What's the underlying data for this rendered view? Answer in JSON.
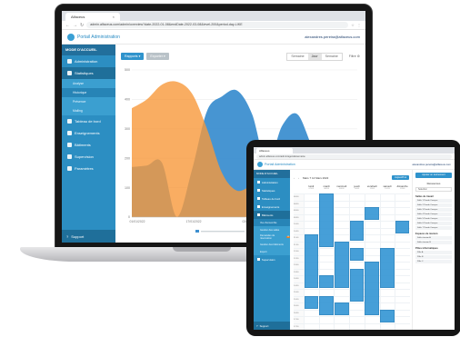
{
  "laptop": {
    "tab_title": "Alfaceus",
    "url": "admin.alfaceus.com/admin/overview?date-2022-01-08&endDate-2022-03-08&level-200&period-day-LIKE",
    "app_brand": "Portail Administration",
    "user": "alexandres.pereira@alfaceus.com",
    "sidebar": {
      "header": "MODE D'ACCUEIL",
      "items": [
        {
          "label": "Administration",
          "icon": "bank-icon",
          "active": false
        },
        {
          "label": "Statistiques",
          "icon": "chart-icon",
          "active": true
        }
      ],
      "subitems": [
        {
          "label": "Analyse",
          "active": false
        },
        {
          "label": "Historique",
          "active": true
        },
        {
          "label": "Présence",
          "active": false
        },
        {
          "label": "Mailing",
          "active": false
        }
      ],
      "items2": [
        {
          "label": "Tableau de bord",
          "icon": "dashboard-icon"
        },
        {
          "label": "Enseignements",
          "icon": "book-icon"
        },
        {
          "label": "Bâtiments",
          "icon": "building-icon"
        },
        {
          "label": "Supervision",
          "icon": "eye-icon"
        },
        {
          "label": "Paramètres",
          "icon": "gear-icon"
        }
      ],
      "support": "Support"
    },
    "toolbar": {
      "rapports": "Rapports ▾",
      "exports": "Exporter ▾",
      "segments": [
        "Semaine",
        "Jour",
        "Semaine"
      ],
      "segment_active": 1,
      "filter": "Filtre"
    },
    "chart_data": {
      "type": "area",
      "title": "",
      "xlabel": "",
      "ylabel": "",
      "ylim": [
        0,
        500
      ],
      "yticks": [
        0,
        100,
        200,
        300,
        400,
        500
      ],
      "x_tick_labels": [
        "01/01/2022",
        "17/01/2022",
        "02/02/2022",
        "18/02/2022"
      ],
      "series": [
        {
          "color": "#3d8fd0",
          "values": [
            170,
            175,
            185,
            0,
            160,
            360,
            410,
            430,
            350,
            180,
            310,
            350,
            240,
            150,
            120,
            110
          ]
        },
        {
          "color": "#f7983b",
          "values": [
            370,
            400,
            450,
            460,
            420,
            300,
            150,
            90,
            110,
            140,
            180,
            160,
            220,
            180,
            150,
            130
          ]
        }
      ],
      "grid": true,
      "legend_position": "bottom"
    }
  },
  "tablet": {
    "tab_title": "Alfaceus",
    "url": "admin.alfaceus.com/admin/agenda/semaine",
    "app_brand": "Portail Administration",
    "user": "alexandres.pereira@alfaceus.com",
    "sidebar": {
      "header": "MODE D'ACCUEIL",
      "items": [
        {
          "label": "Administration",
          "active": false
        },
        {
          "label": "Statistiques",
          "active": false
        },
        {
          "label": "Tableau de bord",
          "active": false
        },
        {
          "label": "Enseignements",
          "active": false
        },
        {
          "label": "Bâtiments",
          "active": true
        }
      ],
      "subitems": [
        {
          "label": "Vue d'ensemble",
          "active": true,
          "badge": ""
        },
        {
          "label": "Gestion des salles",
          "active": false,
          "badge": ""
        },
        {
          "label": "Demandes de réservation",
          "active": false,
          "badge": "12"
        },
        {
          "label": "Gestion des bâtiments",
          "active": false,
          "badge": ""
        },
        {
          "label": "Export",
          "active": false,
          "badge": ""
        }
      ],
      "items2": [
        {
          "label": "Supervision",
          "active": false
        }
      ],
      "support": "Support"
    },
    "calendar": {
      "range": "Mars 7 14 Mars 2022",
      "today_label": "Aujourd'hui",
      "days": [
        {
          "name": "lundi",
          "date": "07/03"
        },
        {
          "name": "mardi",
          "date": "08/03"
        },
        {
          "name": "mercredi",
          "date": "09/03"
        },
        {
          "name": "jeudi",
          "date": "10/03"
        },
        {
          "name": "vendredi",
          "date": "11/03"
        },
        {
          "name": "samedi",
          "date": "12/03"
        },
        {
          "name": "dimanche",
          "date": "13/03"
        }
      ],
      "times": [
        "08:00",
        "08:30",
        "09:00",
        "09:30",
        "10:00",
        "10:30",
        "11:00",
        "11:30",
        "12:00",
        "12:30",
        "13:00",
        "13:30",
        "14:00",
        "14:30",
        "15:00",
        "15:30",
        "16:00",
        "16:30",
        "17:00",
        "17:30"
      ]
    },
    "right_panel": {
      "button": "Ajouter un événement",
      "title": "Ressources",
      "select": "Sélection",
      "sections": [
        {
          "title": "Salles de travail",
          "items": [
            "Salle 1 Panda Campus",
            "Salle 2 Panda Campus",
            "Salle 3 Panda Campus",
            "Salle 4 Panda Campus",
            "Salle 5 Panda Campus",
            "Salle 6 Panda Campus",
            "Salle 7 Panda Campus"
          ]
        },
        {
          "title": "Espaces de réunion",
          "items": [
            "Salle réunion A",
            "Salle réunion B"
          ]
        },
        {
          "title": "Pôles informatiques",
          "items": [
            "Pôle A",
            "Pôle B",
            "Pôle C"
          ]
        }
      ]
    }
  }
}
